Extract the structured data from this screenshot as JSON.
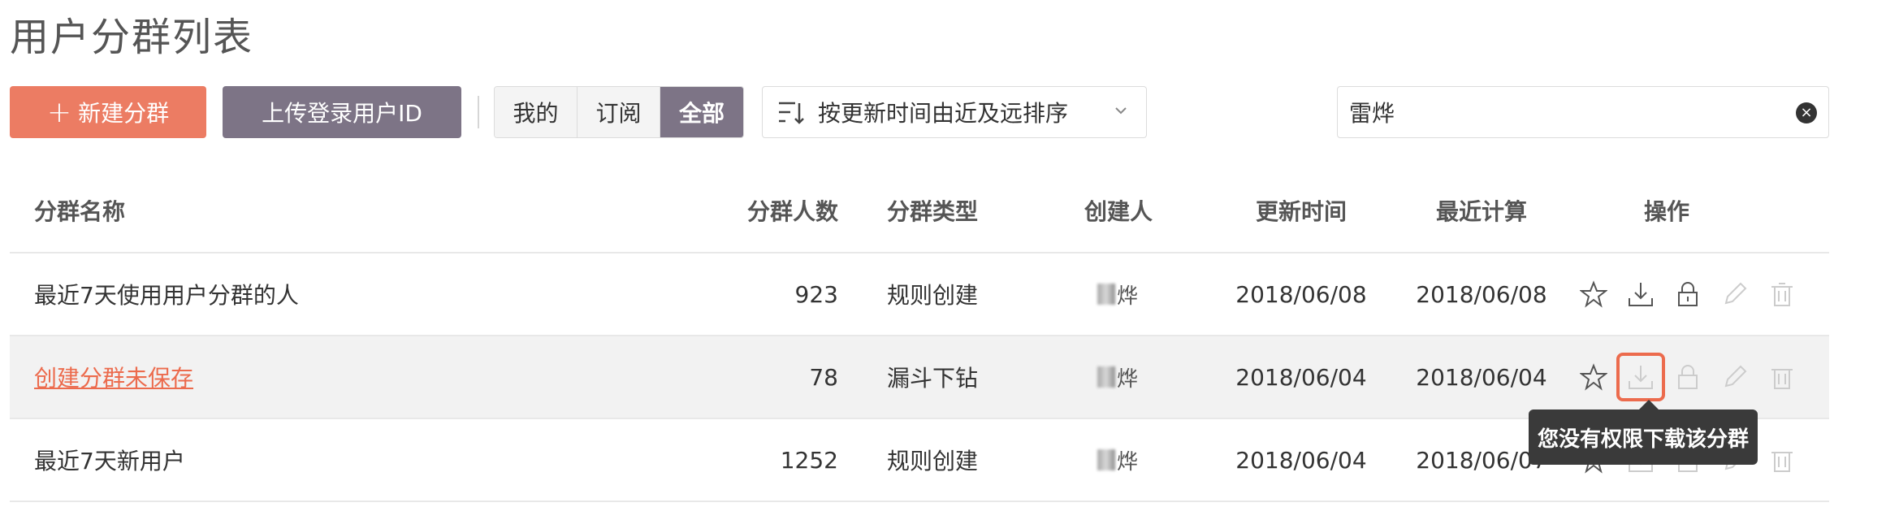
{
  "page": {
    "title": "用户分群列表"
  },
  "toolbar": {
    "new_label": "新建分群",
    "new_plus": "+",
    "upload_label": "上传登录用户ID",
    "filters": [
      "我的",
      "订阅",
      "全部"
    ],
    "active_filter": "全部",
    "sort_label": "按更新时间由近及远排序",
    "search_value": "雷烨",
    "clear_glyph": "×"
  },
  "table": {
    "headers": {
      "name": "分群名称",
      "count": "分群人数",
      "type": "分群类型",
      "creator": "创建人",
      "updated": "更新时间",
      "recent": "最近计算",
      "ops": "操作"
    },
    "rows": [
      {
        "name": "最近7天使用用户分群的人",
        "count": "923",
        "type": "规则创建",
        "creator_suffix": "烨",
        "updated": "2018/06/08",
        "recent": "2018/06/08"
      },
      {
        "name": "创建分群未保存",
        "count": "78",
        "type": "漏斗下钻",
        "creator_suffix": "烨",
        "updated": "2018/06/04",
        "recent": "2018/06/04"
      },
      {
        "name": "最近7天新用户",
        "count": "1252",
        "type": "规则创建",
        "creator_suffix": "烨",
        "updated": "2018/06/04",
        "recent": "2018/06/07"
      }
    ]
  },
  "tooltip": {
    "text": "您没有权限下载该分群"
  },
  "icons": [
    "star-icon",
    "download-icon",
    "lock-icon",
    "edit-icon",
    "trash-icon",
    "sort-icon",
    "chevron-down-icon",
    "clear-icon"
  ],
  "colors": {
    "primary": "#ec7c63",
    "secondary": "#7d7486",
    "link": "#ec6b4d",
    "tooltip_bg": "#3a3a3a"
  }
}
